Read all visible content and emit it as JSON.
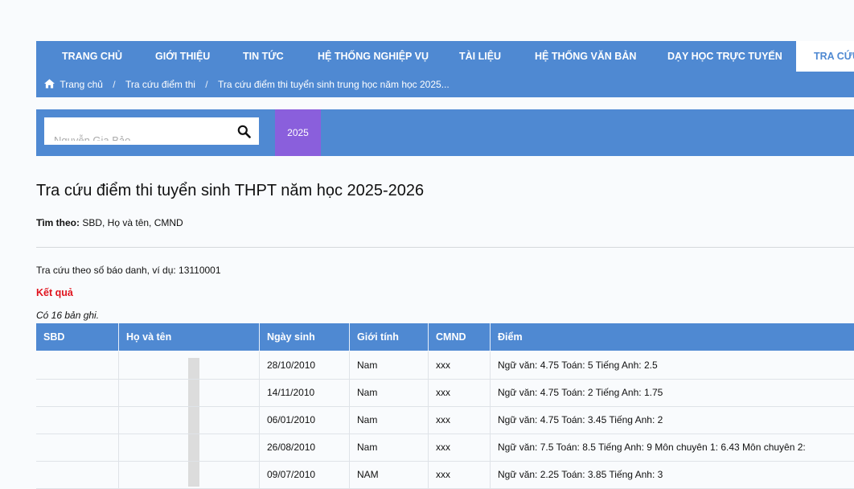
{
  "nav": {
    "menu": [
      "TRANG CHỦ",
      "GIỚI THIỆU",
      "TIN TỨC",
      "HỆ THỐNG NGHIỆP VỤ",
      "TÀI LIỆU",
      "HỆ THỐNG VĂN BẢN",
      "DẠY HỌC TRỰC TUYẾN",
      "TRA CỨU"
    ],
    "breadcrumb": [
      "Trang chủ",
      "Tra cứu điểm thi",
      "Tra cứu điểm thi tuyển sinh trung học năm học 2025..."
    ]
  },
  "search": {
    "value": "Nguyễn Gia Bảo",
    "year": "2025"
  },
  "page": {
    "title": "Tra cứu điểm thi tuyển sinh THPT năm học 2025-2026",
    "find_by_label": "Tìm theo:",
    "find_by_value": "SBD, Họ và tên, CMND",
    "hint": "Tra cứu theo số báo danh, ví dụ: 13110001",
    "result_title": "Kết quả",
    "record_count": "Có 16 bản ghi."
  },
  "table": {
    "headers": [
      "SBD",
      "Họ và tên",
      "Ngày sinh",
      "Giới tính",
      "CMND",
      "Điểm"
    ],
    "rows": [
      {
        "sbd": "",
        "name": "",
        "dob": "28/10/2010",
        "gender": "Nam",
        "cmnd": "xxx",
        "score": "Ngữ văn: 4.75 Toán: 5 Tiếng Anh: 2.5"
      },
      {
        "sbd": "",
        "name": "",
        "dob": "14/11/2010",
        "gender": "Nam",
        "cmnd": "xxx",
        "score": "Ngữ văn: 4.75 Toán: 2 Tiếng Anh: 1.75"
      },
      {
        "sbd": "",
        "name": "",
        "dob": "06/01/2010",
        "gender": "Nam",
        "cmnd": "xxx",
        "score": "Ngữ văn: 4.75 Toán: 3.45 Tiếng Anh: 2"
      },
      {
        "sbd": "",
        "name": "",
        "dob": "26/08/2010",
        "gender": "Nam",
        "cmnd": "xxx",
        "score": "Ngữ văn: 7.5 Toán: 8.5 Tiếng Anh: 9 Môn chuyên 1: 6.43 Môn chuyên 2:"
      },
      {
        "sbd": "",
        "name": "",
        "dob": "09/07/2010",
        "gender": "NAM",
        "cmnd": "xxx",
        "score": "Ngữ văn: 2.25 Toán: 3.85 Tiếng Anh: 3"
      }
    ]
  },
  "colors": {
    "primary": "#4f89d2",
    "year_tab": "#8a5fdc",
    "result_red": "#e0141e"
  }
}
